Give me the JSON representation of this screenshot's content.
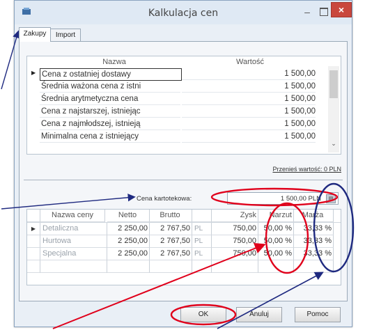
{
  "window": {
    "title": "Kalkulacja cen",
    "icons": {
      "app": "app-icon",
      "minimize": "–",
      "maximize": "maximize-icon",
      "close": "×"
    }
  },
  "tabs": [
    {
      "label": "Zakupy",
      "active": true
    },
    {
      "label": "Import",
      "active": false
    }
  ],
  "prices_grid": {
    "columns": [
      "Nazwa",
      "Wartość"
    ],
    "rows": [
      {
        "name": "Cena z ostatniej dostawy",
        "value": "1 500,00",
        "selected": true
      },
      {
        "name": "Średnia ważona cena z istni",
        "value": "1 500,00"
      },
      {
        "name": "Średnia arytmetyczna cena",
        "value": "1 500,00"
      },
      {
        "name": "Cena z najstarszej, istniejąc",
        "value": "1 500,00"
      },
      {
        "name": "Cena z najmłodszej, istnieją",
        "value": "1 500,00"
      },
      {
        "name": "Minimalna cena z istniejący",
        "value": "1 500,00"
      }
    ],
    "row_indicator": "▶",
    "scroll_down_glyph": "⌄"
  },
  "transfer_link": "Przenieś wartość: 0 PLN",
  "cena_kartotekowa": {
    "label": "Cena kartotekowa:",
    "value": "1 500,00 PLN",
    "button_glyph": "▤"
  },
  "price_types_grid": {
    "columns": [
      "Nazwa ceny",
      "Netto",
      "Brutto",
      "",
      "Zysk",
      "Narzut",
      "Marża"
    ],
    "rows": [
      {
        "indicator": "▶",
        "name": "Detaliczna",
        "netto": "2 250,00",
        "brutto": "2 767,50",
        "currency": "PL",
        "zysk": "750,00",
        "narzut": "50,00 %",
        "marza": "33,33 %"
      },
      {
        "indicator": "",
        "name": "Hurtowa",
        "netto": "2 250,00",
        "brutto": "2 767,50",
        "currency": "PL",
        "zysk": "750,00",
        "narzut": "50,00 %",
        "marza": "33,33 %"
      },
      {
        "indicator": "",
        "name": "Specjalna",
        "netto": "2 250,00",
        "brutto": "2 767,50",
        "currency": "PL",
        "zysk": "750,00",
        "narzut": "50,00 %",
        "marza": "33,33 %"
      }
    ]
  },
  "buttons": {
    "ok": "OK",
    "cancel": "Anuluj",
    "help": "Pomoc"
  },
  "colors": {
    "red_annotation": "#e0001b",
    "blue_annotation": "#1f2a80",
    "close_button": "#c9473d"
  }
}
